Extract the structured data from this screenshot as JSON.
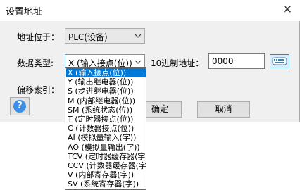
{
  "window": {
    "title": "设置地址",
    "close_glyph": "✕"
  },
  "form": {
    "location_label": "地址位于：",
    "location_value": "PLC(设备)",
    "type_label": "数据类型:",
    "type_value": "X (输入接点(位))",
    "decimal_label": "10进制地址：",
    "decimal_value": "0000",
    "offset_label": "偏移索引："
  },
  "buttons": {
    "ok": "确定",
    "cancel": "取消",
    "help": "?"
  },
  "dropdown": {
    "selected_index": 0,
    "items": [
      "X (输入接点(位))",
      "Y (输出继电器(位))",
      "S (步进继电器(位))",
      "M (内部继电器(位))",
      "SM (系统状态(位))",
      "T (定时器接点(位))",
      "C (计数器接点(位))",
      "AI (模拟量输入(字))",
      "AO (模拟量输出(字))",
      "TCV (定时器缓存器(字",
      "CCV (计数器缓存器(字",
      "V (内部寄存器(字))",
      "SV (系统寄存器(字))"
    ]
  },
  "icons": {
    "close": "close-icon",
    "arrow": "chevron-down-icon",
    "keyboard": "keyboard-icon",
    "help": "help-icon"
  },
  "colors": {
    "selection": "#0078d7",
    "focus_border": "#569de5",
    "keyboard_button": "#dcecfc"
  }
}
